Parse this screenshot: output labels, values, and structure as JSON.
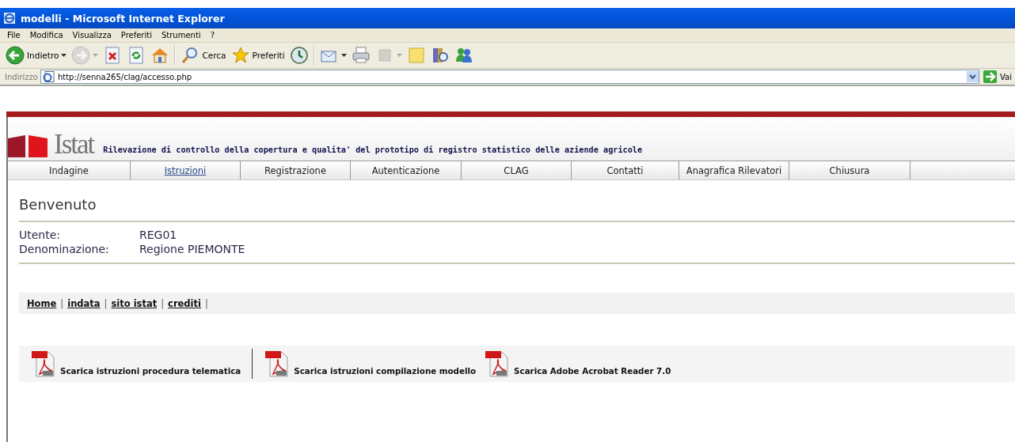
{
  "window": {
    "title": "modelli - Microsoft Internet Explorer"
  },
  "menu": [
    "File",
    "Modifica",
    "Visualizza",
    "Preferiti",
    "Strumenti",
    "?"
  ],
  "toolbar": [
    {
      "kind": "back",
      "label": "Indietro",
      "dropdown": true,
      "disabled": false
    },
    {
      "kind": "forward",
      "dropdown": true,
      "disabled": true
    },
    {
      "kind": "stop",
      "disabled": false
    },
    {
      "kind": "refresh",
      "disabled": false
    },
    {
      "kind": "home",
      "disabled": false
    },
    {
      "kind": "separator"
    },
    {
      "kind": "search",
      "label": "Cerca",
      "disabled": false
    },
    {
      "kind": "favorites",
      "label": "Preferiti",
      "disabled": false
    },
    {
      "kind": "history",
      "disabled": false
    },
    {
      "kind": "separator"
    },
    {
      "kind": "mail",
      "dropdown": true,
      "disabled": false
    },
    {
      "kind": "print",
      "disabled": false
    },
    {
      "kind": "edit",
      "dropdown": true,
      "disabled": true
    },
    {
      "kind": "note",
      "disabled": false
    },
    {
      "kind": "research",
      "disabled": false
    },
    {
      "kind": "messenger",
      "disabled": false
    }
  ],
  "address": {
    "label": "Indirizzo",
    "value": "http://senna265/clag/accesso.php",
    "go": "Vai"
  },
  "site": {
    "logo": "Istat",
    "title": "Rilevazione di controllo della copertura e qualita' del prototipo di registro statistico delle aziende agricole"
  },
  "nav": [
    {
      "label": "Indagine",
      "selected": false
    },
    {
      "label": "Istruzioni",
      "selected": true
    },
    {
      "label": "Registrazione",
      "selected": false
    },
    {
      "label": "Autenticazione",
      "selected": false
    },
    {
      "label": "CLAG",
      "selected": false
    },
    {
      "label": "Contatti",
      "selected": false
    },
    {
      "label": "Anagrafica Rilevatori",
      "selected": false
    },
    {
      "label": "Chiusura",
      "selected": false
    }
  ],
  "welcome": {
    "heading": "Benvenuto",
    "fields": [
      {
        "label": "Utente:",
        "value": "REG01"
      },
      {
        "label": "Denominazione:",
        "value": "Regione PIEMONTE"
      }
    ]
  },
  "links": {
    "separator": "|",
    "items": [
      "Home",
      "indata",
      "sito istat",
      "crediti"
    ]
  },
  "downloads": [
    {
      "label": "Scarica istruzioni procedura telematica",
      "divider": true
    },
    {
      "label": "Scarica istruzioni compilazione modello",
      "divider": false
    },
    {
      "label": "Scarica Adobe Acrobat Reader 7.0",
      "divider": false
    }
  ]
}
